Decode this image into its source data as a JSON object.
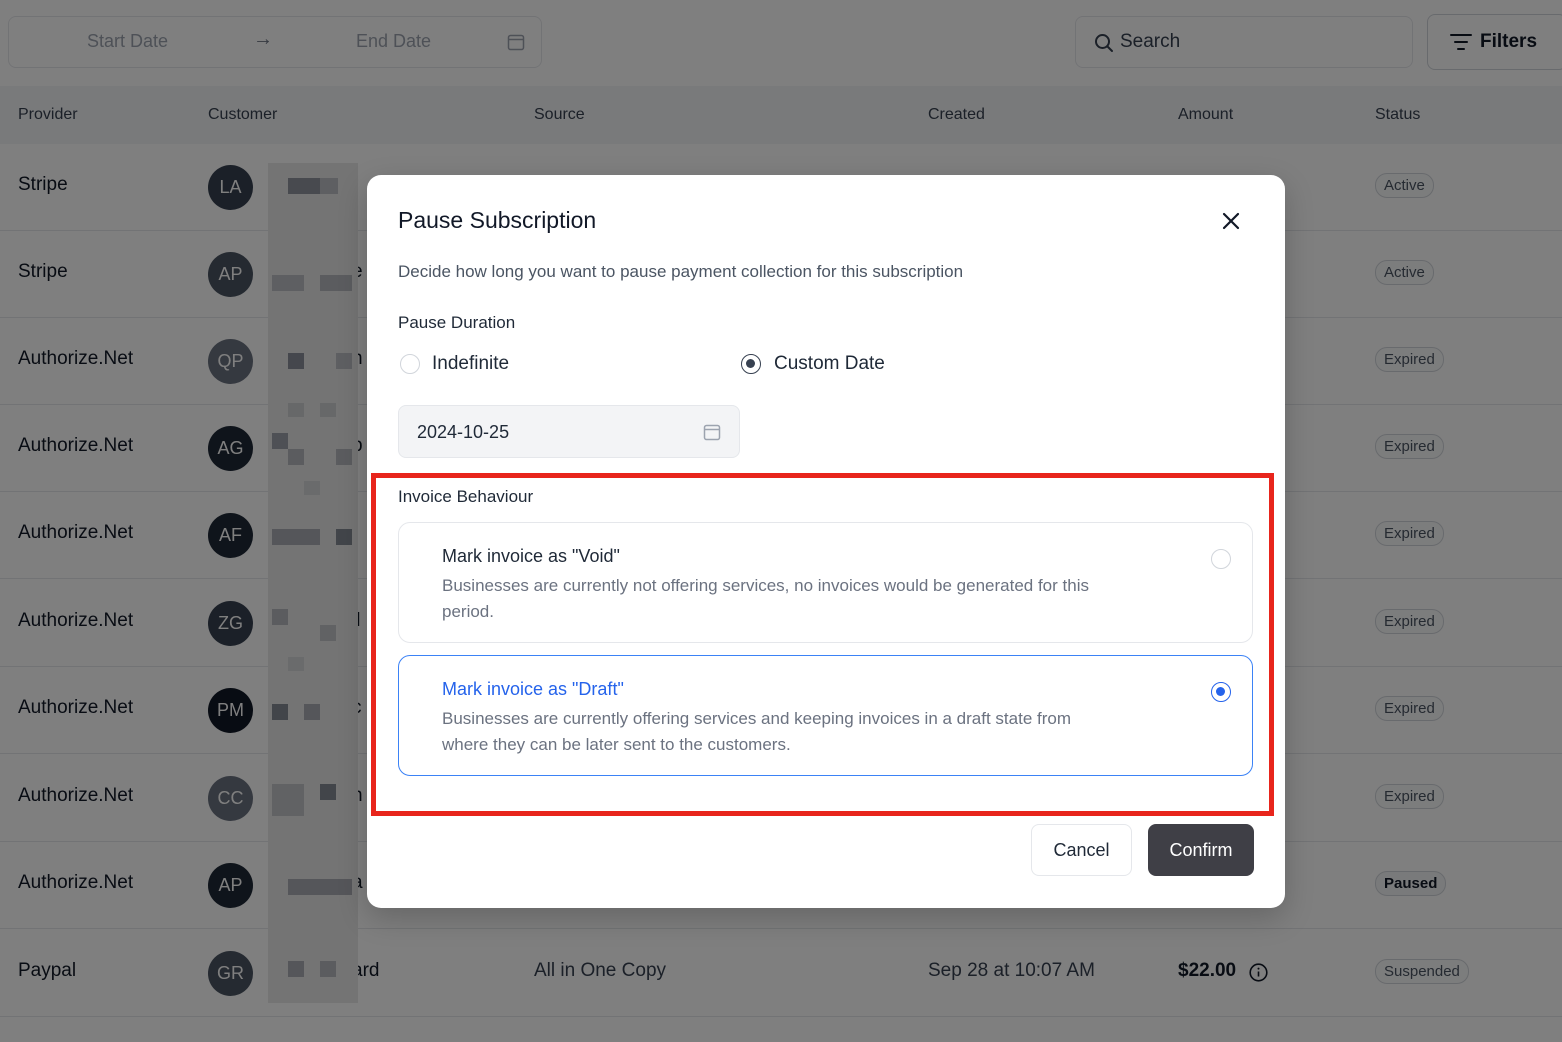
{
  "toolbar": {
    "start_date_placeholder": "Start Date",
    "arrow": "→",
    "end_date_placeholder": "End Date",
    "search_label": "Search",
    "filters_label": "Filters"
  },
  "table": {
    "headers": {
      "provider": "Provider",
      "customer": "Customer",
      "source": "Source",
      "created": "Created",
      "amount": "Amount",
      "status": "Status"
    },
    "rows": [
      {
        "provider": "Stripe",
        "initials": "LA",
        "customer_fragment": "r",
        "source": "",
        "created": "",
        "amount": "",
        "status": "Active"
      },
      {
        "provider": "Stripe",
        "initials": "AP",
        "customer_fragment": "e",
        "source": "",
        "created": "",
        "amount": "",
        "status": "Active"
      },
      {
        "provider": "Authorize.Net",
        "initials": "QP",
        "customer_fragment": "h",
        "source": "",
        "created": "",
        "amount": "",
        "status": "Expired"
      },
      {
        "provider": "Authorize.Net",
        "initials": "AG",
        "customer_fragment": "b",
        "source": "",
        "created": "",
        "amount": "",
        "status": "Expired"
      },
      {
        "provider": "Authorize.Net",
        "initials": "AF",
        "customer_fragment": "",
        "source": "",
        "created": "",
        "amount": "",
        "status": "Expired"
      },
      {
        "provider": "Authorize.Net",
        "initials": "ZG",
        "customer_fragment": "il",
        "source": "",
        "created": "",
        "amount": "",
        "status": "Expired"
      },
      {
        "provider": "Authorize.Net",
        "initials": "PM",
        "customer_fragment": "c",
        "source": "",
        "created": "",
        "amount": "",
        "status": "Expired"
      },
      {
        "provider": "Authorize.Net",
        "initials": "CC",
        "customer_fragment": "h",
        "source": "",
        "created": "",
        "amount": "",
        "status": "Expired"
      },
      {
        "provider": "Authorize.Net",
        "initials": "AP",
        "customer_fragment": "a",
        "source": "",
        "created": "",
        "amount": "",
        "status": "Paused"
      },
      {
        "provider": "Paypal",
        "initials": "GR",
        "customer_fragment": "ard",
        "source": "All in One Copy",
        "created": "Sep 28 at 10:07 AM",
        "amount": "$22.00",
        "status": "Suspended"
      }
    ]
  },
  "modal": {
    "title": "Pause Subscription",
    "description": "Decide how long you want to pause payment collection for this subscription",
    "pause_duration_label": "Pause Duration",
    "option_indefinite": "Indefinite",
    "option_custom_date": "Custom Date",
    "selected_duration": "Custom Date",
    "date_value": "2024-10-25",
    "invoice_behaviour_label": "Invoice Behaviour",
    "void_title": "Mark invoice as \"Void\"",
    "void_description": "Businesses are currently not offering services, no invoices would be generated for this period.",
    "draft_title": "Mark invoice as \"Draft\"",
    "draft_description": "Businesses are currently offering services and keeping invoices in a draft state from where they can be later sent to the customers.",
    "selected_invoice_behaviour": "Draft",
    "cancel_label": "Cancel",
    "confirm_label": "Confirm"
  },
  "colors": {
    "accent": "#2563eb",
    "highlight_border": "#e8251c",
    "confirm_button": "#3f3f46",
    "overlay": "rgba(0,0,0,0.5)"
  },
  "icons": [
    "calendar-icon",
    "search-icon",
    "filter-icon",
    "close-icon",
    "info-icon"
  ]
}
